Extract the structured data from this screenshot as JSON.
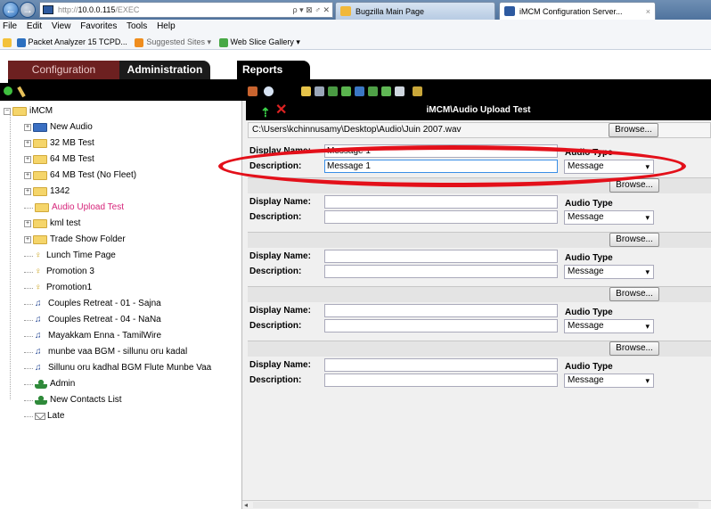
{
  "browser": {
    "url_prefix": "http://",
    "url_host": "10.0.0.115",
    "url_path": "/EXEC",
    "addr_icons": "ρ ▾ ⊠ ♂ ✕",
    "tabs": [
      {
        "label": "Bugzilla Main Page"
      },
      {
        "label": "iMCM Configuration Server...",
        "close": "×"
      }
    ],
    "menu": [
      "File",
      "Edit",
      "View",
      "Favorites",
      "Tools",
      "Help"
    ],
    "favorites": [
      {
        "label": "Packet Analyzer 15 TCPD..."
      },
      {
        "label": "Suggested Sites ▾"
      },
      {
        "label": "Web Slice Gallery ▾"
      }
    ]
  },
  "nav": {
    "tabs": [
      "Configuration",
      "Administration",
      "Reports"
    ]
  },
  "tree": {
    "items": [
      {
        "label": "iMCM"
      },
      {
        "label": "New Audio"
      },
      {
        "label": "32 MB Test"
      },
      {
        "label": "64 MB Test"
      },
      {
        "label": "64 MB Test (No Fleet)"
      },
      {
        "label": "1342"
      },
      {
        "label": "Audio Upload Test"
      },
      {
        "label": "kml test"
      },
      {
        "label": "Trade Show Folder"
      },
      {
        "label": "Lunch Time Page"
      },
      {
        "label": "Promotion 3"
      },
      {
        "label": "Promotion1"
      },
      {
        "label": "Couples Retreat - 01 - Sajna"
      },
      {
        "label": "Couples Retreat - 04 - NaNa"
      },
      {
        "label": "Mayakkam Enna - TamilWire"
      },
      {
        "label": "munbe vaa BGM - sillunu oru kadal"
      },
      {
        "label": "Sillunu oru kadhal BGM Flute Munbe Vaa"
      },
      {
        "label": "Admin"
      },
      {
        "label": "New Contacts List"
      },
      {
        "label": "Late"
      }
    ]
  },
  "panel": {
    "title": "iMCM\\Audio Upload Test",
    "browse_label": "Browse...",
    "display_name_label": "Display Name:",
    "description_label": "Description:",
    "audio_type_label": "Audio Type",
    "rows": [
      {
        "path": "C:\\Users\\kchinnusamy\\Desktop\\Audio\\Juin 2007.wav",
        "display_name": "Message 1",
        "description": "Message 1",
        "audio_type": "Message"
      },
      {
        "path": "",
        "display_name": "",
        "description": "",
        "audio_type": "Message"
      },
      {
        "path": "",
        "display_name": "",
        "description": "",
        "audio_type": "Message"
      },
      {
        "path": "",
        "display_name": "",
        "description": "",
        "audio_type": "Message"
      },
      {
        "path": "",
        "display_name": "",
        "description": "",
        "audio_type": "Message"
      }
    ]
  },
  "colors": {
    "accent_red": "#e3101a",
    "selected_item": "#d6247a",
    "config_tab": "#6d2020"
  }
}
